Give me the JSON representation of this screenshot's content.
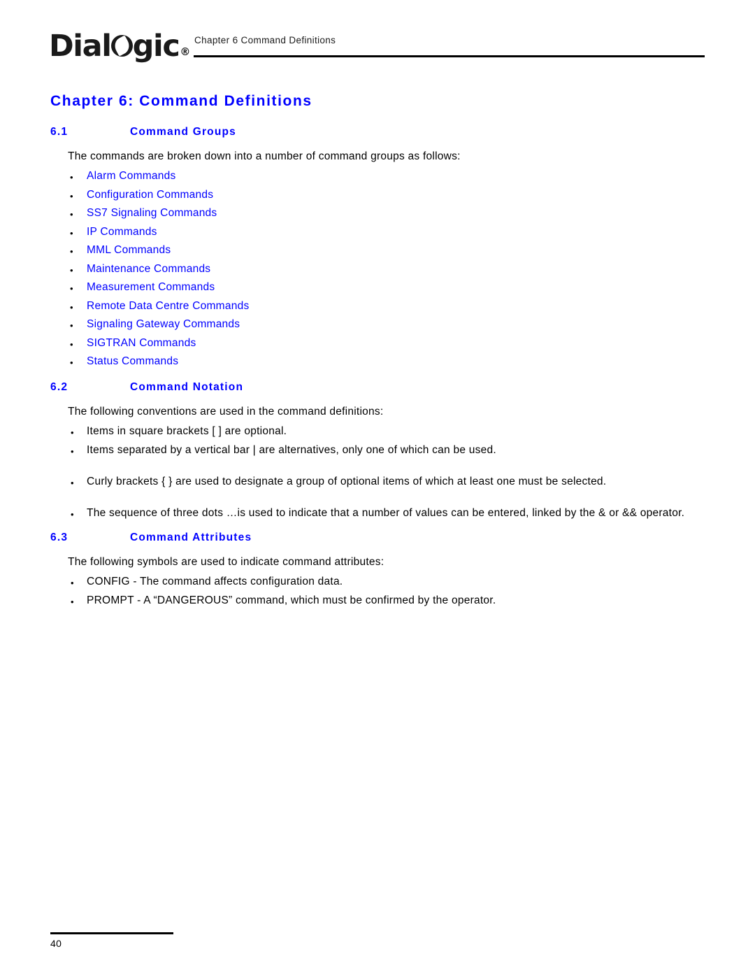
{
  "header": {
    "logo_text_left": "Dial",
    "logo_icon": "dialogic-o-leaf",
    "logo_text_right": "gic",
    "logo_registered": "®",
    "chapter_label": "Chapter 6 Command Definitions"
  },
  "colors": {
    "link_blue": "#0000ff",
    "heading_blue": "#0000ff",
    "body_black": "#000000",
    "rule_black": "#000000"
  },
  "page": {
    "title": "Chapter 6:  Command Definitions"
  },
  "sections": [
    {
      "number": "6.1",
      "name": "Command Groups",
      "intro": "The commands are broken down into a number of command groups as follows:",
      "bullet_style": "links",
      "bullets": [
        "Alarm Commands",
        "Configuration Commands",
        "SS7 Signaling Commands",
        "IP Commands",
        "MML Commands",
        "Maintenance Commands",
        "Measurement Commands",
        "Remote Data Centre Commands",
        "Signaling Gateway Commands",
        "SIGTRAN Commands",
        "Status Commands"
      ]
    },
    {
      "number": "6.2",
      "name": "Command Notation",
      "intro": "The following conventions are used in the command definitions:",
      "bullet_style": "plain",
      "bullets": [
        "Items in square brackets [ ] are optional.",
        "Items separated by a vertical bar | are alternatives, only one of which can be used.",
        "Curly brackets { }  are used to designate a group of optional items of which at least one must be selected.",
        "The sequence of three dots …is used to indicate that a number of values can be entered, linked by the & or && operator."
      ]
    },
    {
      "number": "6.3",
      "name": "Command Attributes",
      "intro": "The following symbols are used to indicate command attributes:",
      "bullet_style": "plain",
      "bullets": [
        "CONFIG - The command affects configuration data.",
        "PROMPT - A “DANGEROUS” command, which must be confirmed by the operator."
      ]
    }
  ],
  "footer": {
    "page_number": "40"
  }
}
